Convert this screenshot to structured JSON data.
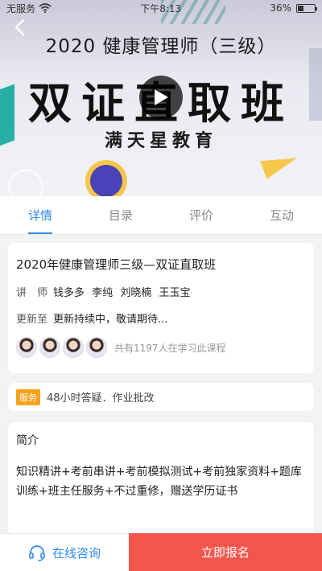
{
  "status_bar": {
    "carrier": "无服务",
    "time": "下午8:13",
    "battery_percent": "36%",
    "battery_level": 0.36
  },
  "hero": {
    "title": "2020 健康管理师（三级）",
    "big_title": "双证直取班",
    "brand": "满天星教育"
  },
  "tabs": [
    {
      "label": "详情",
      "active": true
    },
    {
      "label": "目录",
      "active": false
    },
    {
      "label": "评价",
      "active": false
    },
    {
      "label": "互动",
      "active": false
    }
  ],
  "course": {
    "title": "2020年健康管理师三级—双证直取班",
    "teacher_label": "讲　师",
    "teachers": [
      "钱多多",
      "李纯",
      "刘晓楠",
      "王玉宝"
    ],
    "update_label": "更新至",
    "update_value": "更新持续中，敬请期待...",
    "learners_text": "共有1197人在学习此课程"
  },
  "service": {
    "badge": "服务",
    "text": "48小时答疑．作业批改"
  },
  "intro": {
    "heading": "简介",
    "body": "知识精讲+考前串讲+考前模拟测试+考前独家资料+题库训练+班主任服务+不过重修，赠送学历证书"
  },
  "bottom": {
    "consult_label": "在线咨询",
    "enroll_label": "立即报名"
  },
  "colors": {
    "accent": "#2d8cf0",
    "enroll": "#f2574d",
    "badge": "#f7a21b"
  },
  "icons": [
    "back-icon",
    "play-icon",
    "headset-icon",
    "wifi-icon",
    "battery-icon"
  ]
}
